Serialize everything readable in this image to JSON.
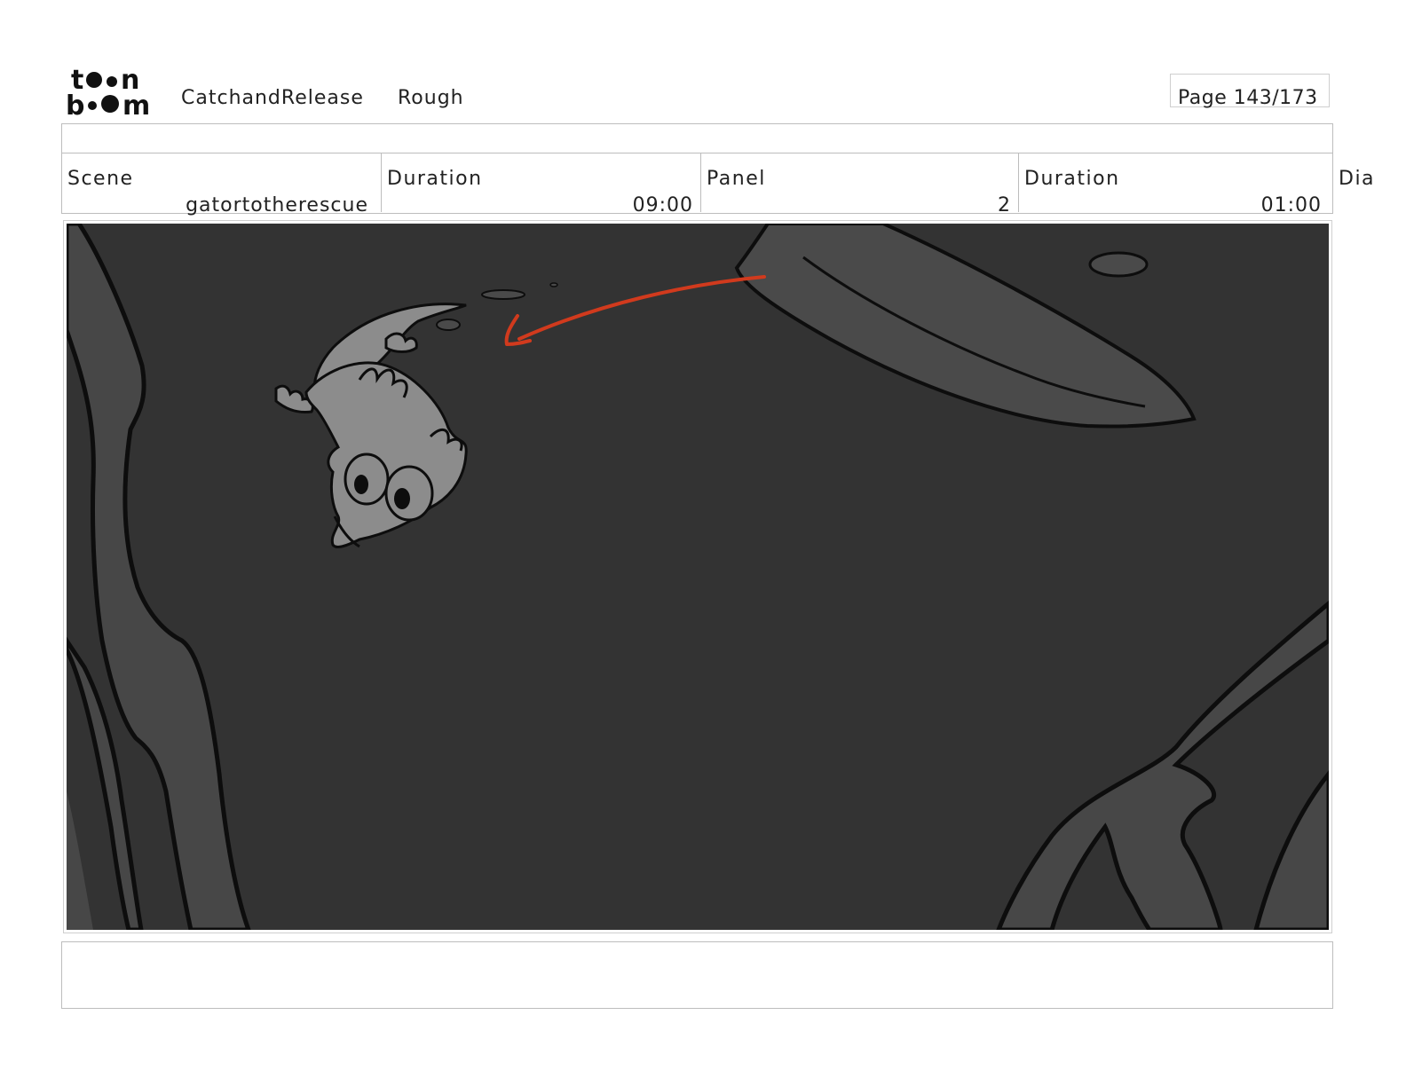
{
  "header": {
    "logo_text_top": "toon",
    "logo_text_bottom": "boom",
    "project": "CatchandRelease",
    "version": "Rough",
    "page": "Page 143/173"
  },
  "info": {
    "scene_label": "Scene",
    "scene_value": "gatortotherescue",
    "scene_duration_label": "Duration",
    "scene_duration_value": "09:00",
    "panel_label": "Panel",
    "panel_value": "2",
    "panel_duration_label": "Duration",
    "panel_duration_value": "01:00",
    "dialogue_label": "Dia"
  },
  "colors": {
    "background": "#333333",
    "shape": "#4a4a4a",
    "character": "#8c8c8c",
    "arrow": "#d13a1d"
  },
  "panel_image": {
    "icons": [
      "gator-character",
      "red-motion-arrow",
      "rock-formation",
      "fish-silhouette",
      "bubble"
    ]
  }
}
